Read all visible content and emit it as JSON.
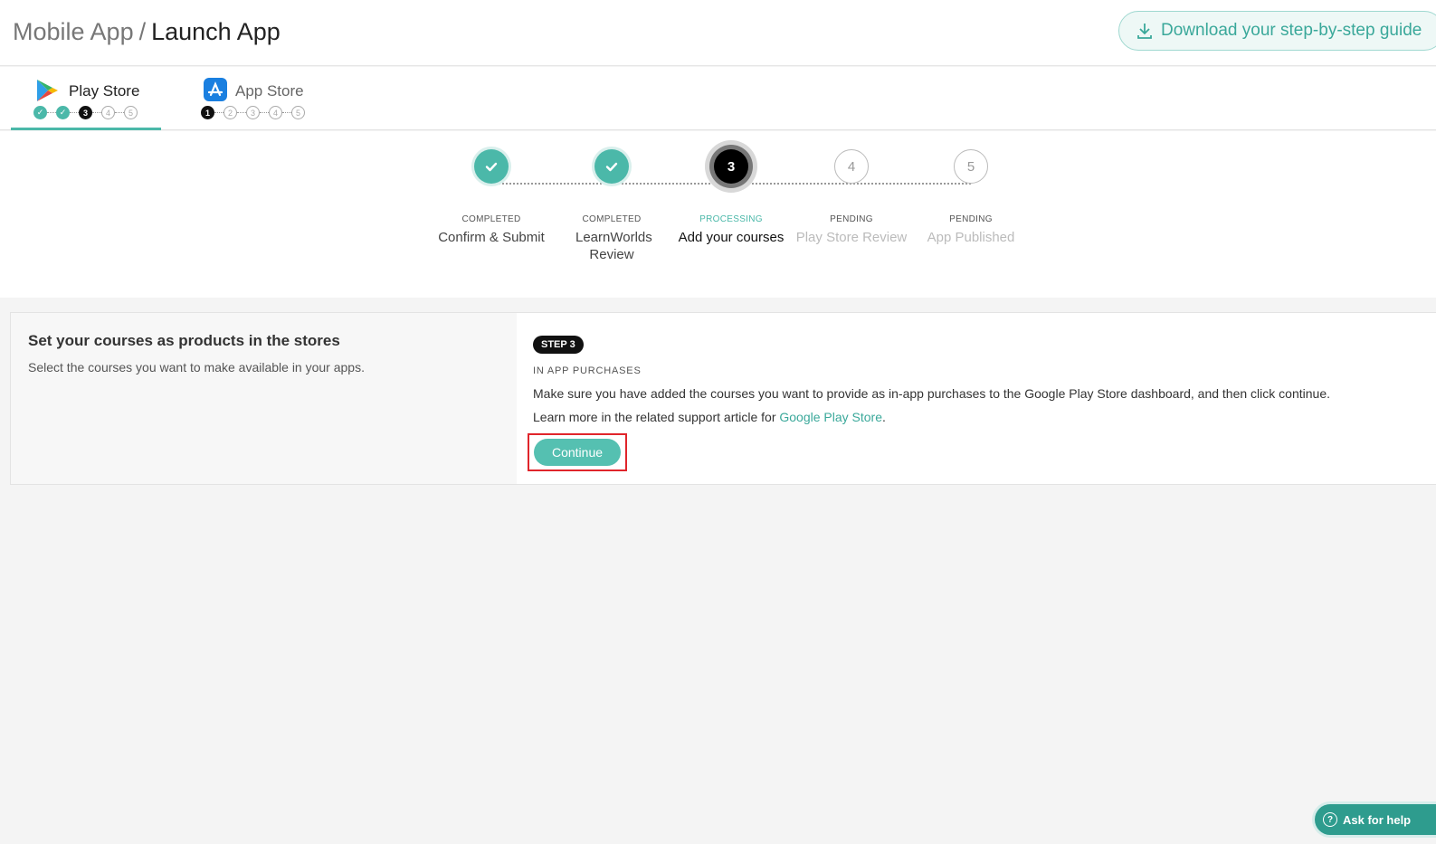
{
  "header": {
    "breadcrumb_parent": "Mobile App",
    "breadcrumb_sep": "/",
    "breadcrumb_current": "Launch App",
    "guide_button": "Download your step-by-step guide"
  },
  "tabs": [
    {
      "label": "Play Store",
      "icon": "google-play-icon",
      "mini_steps": [
        "done",
        "done",
        "3",
        "4",
        "5"
      ]
    },
    {
      "label": "App Store",
      "icon": "app-store-icon",
      "mini_steps": [
        "1",
        "2",
        "3",
        "4",
        "5"
      ]
    }
  ],
  "stepper": {
    "steps": [
      {
        "status": "COMPLETED",
        "title": "Confirm & Submit",
        "number": "1",
        "state": "done"
      },
      {
        "status": "COMPLETED",
        "title": "LearnWorlds Review",
        "number": "2",
        "state": "done"
      },
      {
        "status": "PROCESSING",
        "title": "Add your courses",
        "number": "3",
        "state": "active"
      },
      {
        "status": "PENDING",
        "title": "Play Store Review",
        "number": "4",
        "state": "pending"
      },
      {
        "status": "PENDING",
        "title": "App Published",
        "number": "5",
        "state": "pending"
      }
    ]
  },
  "card": {
    "title": "Set your courses as products in the stores",
    "subtitle": "Select the courses you want to make available in your apps.",
    "step_badge": "STEP 3",
    "section_label": "IN APP PURCHASES",
    "description": "Make sure you have added the courses you want to provide as in-app purchases to the Google Play Store dashboard, and then click continue.",
    "learn_prefix": "Learn more in the related support article for ",
    "learn_link": "Google Play Store",
    "learn_suffix": ".",
    "continue_button": "Continue"
  },
  "help": {
    "label": "Ask for help",
    "icon": "question-icon"
  },
  "colors": {
    "accent": "#4bb8a9",
    "highlight": "#e0252b"
  }
}
